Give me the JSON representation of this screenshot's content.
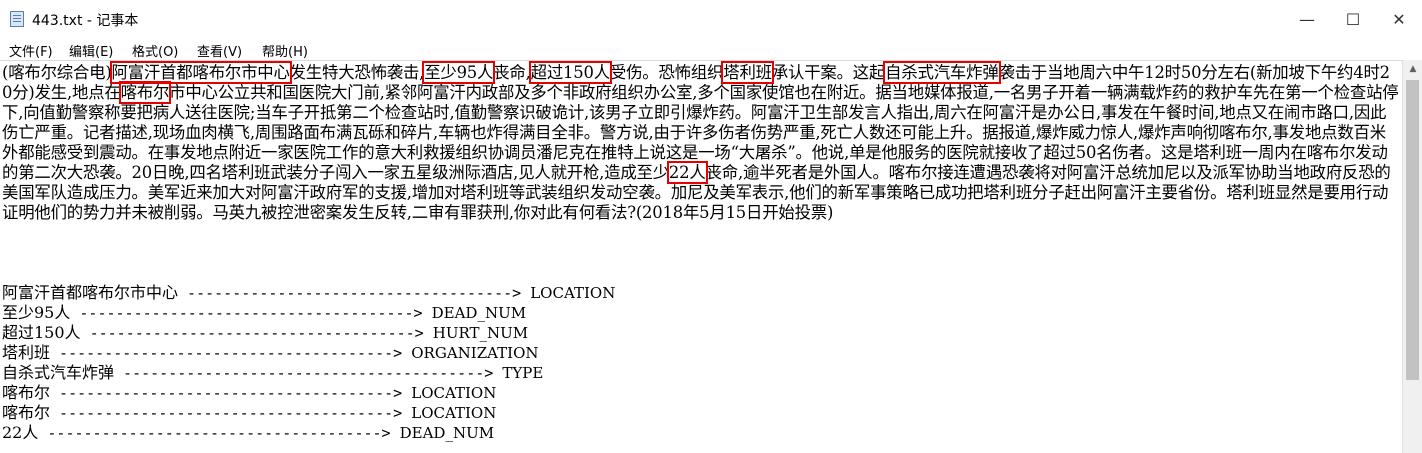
{
  "window": {
    "title": "443.txt - 记事本",
    "minimize_glyph": "—",
    "maximize_glyph": "☐",
    "close_glyph": "✕"
  },
  "menu": [
    "文件(F)",
    "编辑(E)",
    "格式(O)",
    "查看(V)",
    "帮助(H)"
  ],
  "paragraph": [
    {
      "t": "(喀布尔综合电)"
    },
    {
      "t": "阿富汗首都喀布尔市中心",
      "h": true
    },
    {
      "t": "发生特大恐怖袭击,"
    },
    {
      "t": "至少95人",
      "h": true
    },
    {
      "t": "丧命,"
    },
    {
      "t": "超过150人",
      "h": true
    },
    {
      "t": "受伤。恐怖组织"
    },
    {
      "t": "塔利班",
      "h": true
    },
    {
      "t": "承认干案。这起"
    },
    {
      "t": "自杀式汽车炸弹",
      "h": true
    },
    {
      "t": "袭击于当地周六中午12时50分左右(新加坡下午约4时20分)发生,地点在"
    },
    {
      "t": "喀布尔",
      "h": true
    },
    {
      "t": "市中心公立共和国医院大门前,紧邻阿富汗内政部及多个非政府组织办公室,多个国家使馆也在附近。据当地媒体报道,一名男子开着一辆满载炸药的救护车先在第一个检查站停下,向值勤警察称要把病人送往医院;当车子开抵第二个检查站时,值勤警察识破诡计,该男子立即引爆炸药。阿富汗卫生部发言人指出,周六在阿富汗是办公日,事发在午餐时间,地点又在闹市路口,因此伤亡严重。记者描述,现场血肉横飞,周围路面布满瓦砾和碎片,车辆也炸得满目全非。警方说,由于许多伤者伤势严重,死亡人数还可能上升。据报道,爆炸威力惊人,爆炸声响彻喀布尔,事发地点数百米外都能感受到震动。在事发地点附近一家医院工作的意大利救援组织协调员潘尼克在推特上说这是一场“大屠杀”。他说,单是他服务的医院就接收了超过50名伤者。这是塔利班一周内在喀布尔发动的第二次大恐袭。20日晚,四名塔利班武装分子闯入一家五星级洲际酒店,见人就开枪,造成至少"
    },
    {
      "t": "22人",
      "h": true
    },
    {
      "t": "丧命,逾半死者是外国人。喀布尔接连遭遇恐袭将对阿富汗总统加尼以及派军协助当地政府反恐的美国军队造成压力。美军近来加大对阿富汗政府军的支援,增加对塔利班等武装组织发动空袭。加尼及美军表示,他们的新军事策略已成功把塔利班分子赶出阿富汗主要省份。塔利班显然是要用行动证明他们的势力并未被削弱。马英九被控泄密案发生反转,二审有罪获刑,你对此有何看法?(2018年5月15日开始投票)"
    }
  ],
  "relations": [
    {
      "entity": "阿富汗首都喀布尔市中心",
      "arrow": " ------------------------------------> ",
      "label": "LOCATION"
    },
    {
      "entity": "至少95人",
      "arrow": " -------------------------------------> ",
      "label": "DEAD_NUM"
    },
    {
      "entity": "超过150人",
      "arrow": " ------------------------------------> ",
      "label": "HURT_NUM"
    },
    {
      "entity": "塔利班",
      "arrow": " -------------------------------------> ",
      "label": "ORGANIZATION"
    },
    {
      "entity": "自杀式汽车炸弹",
      "arrow": " ----------------------------------------> ",
      "label": "TYPE"
    },
    {
      "entity": "喀布尔",
      "arrow": " -------------------------------------> ",
      "label": "LOCATION"
    },
    {
      "entity": "喀布尔",
      "arrow": " -------------------------------------> ",
      "label": "LOCATION"
    },
    {
      "entity": "22人",
      "arrow": " -------------------------------------> ",
      "label": "DEAD_NUM"
    }
  ],
  "colors": {
    "highlight_border": "#e60000",
    "background": "#ffffff"
  }
}
